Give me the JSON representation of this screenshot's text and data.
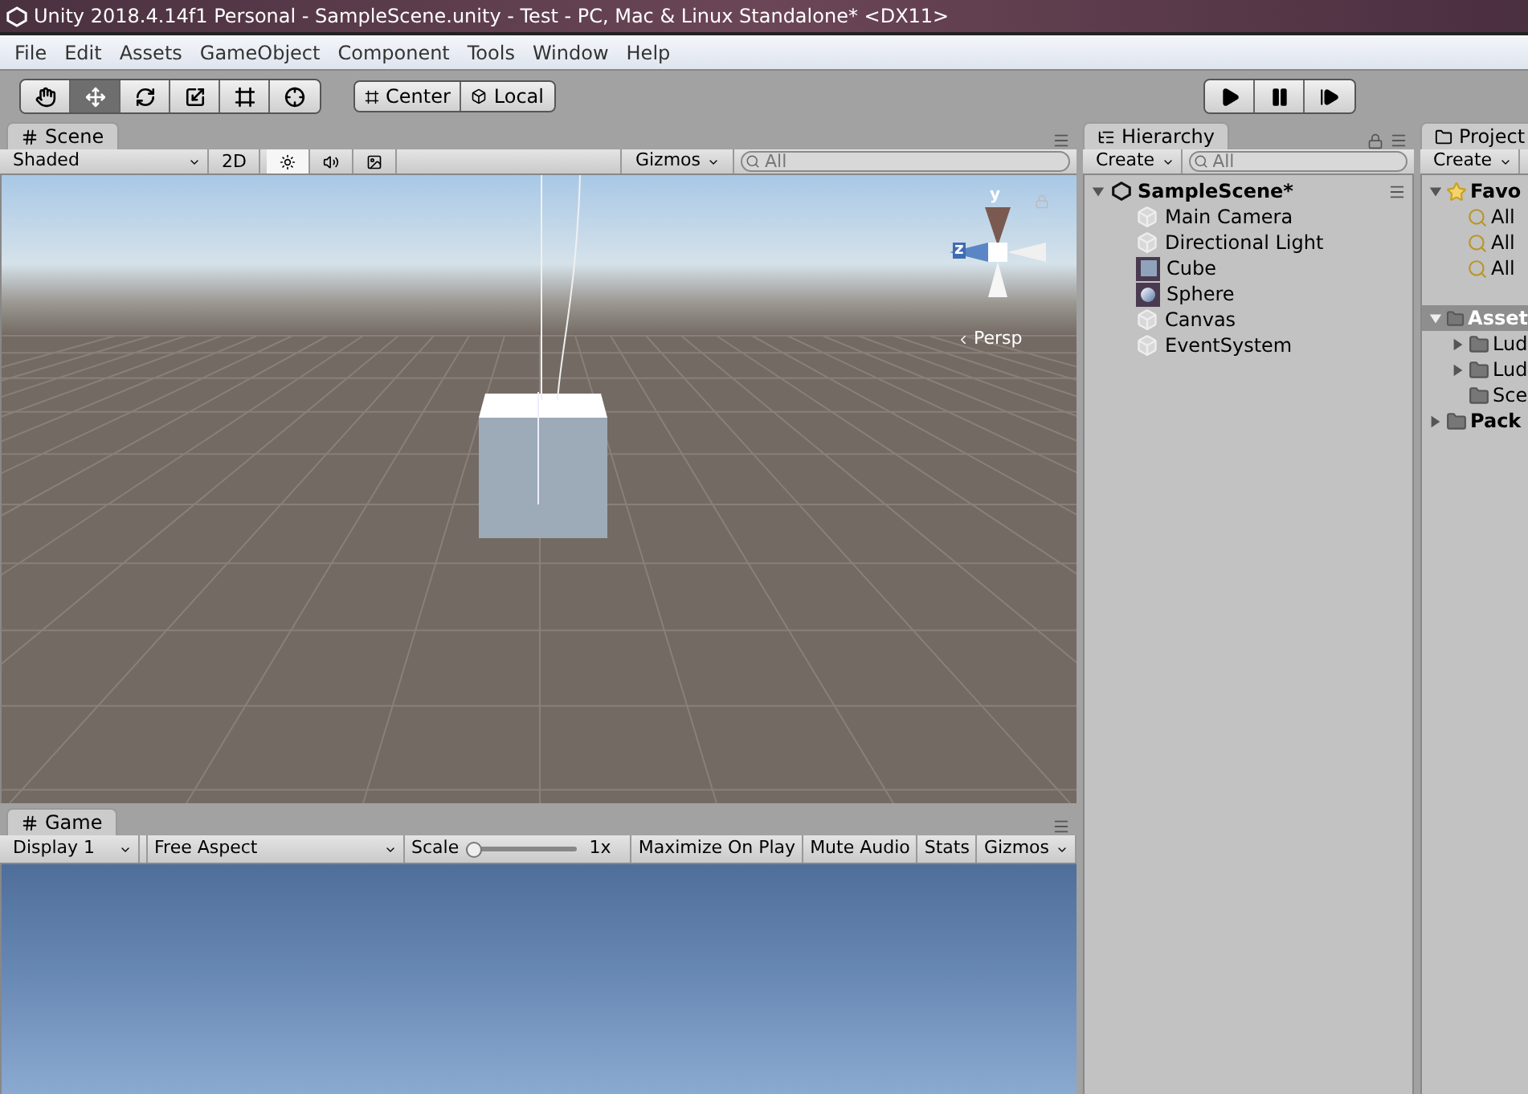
{
  "window": {
    "title": "Unity 2018.4.14f1 Personal - SampleScene.unity - Test - PC, Mac & Linux Standalone* <DX11>"
  },
  "menu": [
    "File",
    "Edit",
    "Assets",
    "GameObject",
    "Component",
    "Tools",
    "Window",
    "Help"
  ],
  "tools": [
    {
      "kind": "hand",
      "selected": false
    },
    {
      "kind": "move",
      "selected": true
    },
    {
      "kind": "rotate",
      "selected": false
    },
    {
      "kind": "scale",
      "selected": false
    },
    {
      "kind": "rect",
      "selected": false
    },
    {
      "kind": "transform",
      "selected": false
    }
  ],
  "pivot": [
    {
      "kind": "pivot",
      "label": "Center"
    },
    {
      "kind": "space",
      "label": "Local"
    }
  ],
  "play_controls": [
    {
      "kind": "play",
      "selected": false
    },
    {
      "kind": "pause",
      "selected": false
    },
    {
      "kind": "step",
      "selected": false
    }
  ],
  "scene": {
    "tab": "Scene",
    "shading": "Shaded",
    "mode_2d": {
      "label": "2D",
      "selected": false
    },
    "toggles": [
      {
        "kind": "lighting",
        "selected": true
      },
      {
        "kind": "audio",
        "selected": false
      },
      {
        "kind": "effects",
        "selected": false
      }
    ],
    "gizmos": "Gizmos",
    "search": {
      "placeholder": "All"
    },
    "gizmo_axes": {
      "y": "y",
      "z": "z",
      "projection": "Persp"
    }
  },
  "hierarchy": {
    "tab": "Hierarchy",
    "create": "Create",
    "search": {
      "placeholder": "All"
    },
    "scene": "SampleScene*",
    "items": [
      {
        "label": "Main Camera",
        "kind": "gameobject"
      },
      {
        "label": "Directional Light",
        "kind": "gameobject"
      },
      {
        "label": "Cube",
        "kind": "cube"
      },
      {
        "label": "Sphere",
        "kind": "sphere"
      },
      {
        "label": "Canvas",
        "kind": "gameobject"
      },
      {
        "label": "EventSystem",
        "kind": "gameobject"
      }
    ]
  },
  "project": {
    "tab": "Project",
    "create": "Create",
    "favorites": {
      "label": "Favo",
      "expanded": true,
      "children": [
        {
          "label": "All"
        },
        {
          "label": "All"
        },
        {
          "label": "All"
        }
      ]
    },
    "folders": [
      {
        "label": "Asset",
        "expanded": true,
        "selected": true,
        "children": [
          {
            "label": "Lud",
            "expanded": false
          },
          {
            "label": "Lud",
            "expanded": false
          },
          {
            "label": "Sce"
          }
        ]
      },
      {
        "label": "Pack",
        "expanded": false,
        "selected": false
      }
    ]
  },
  "game": {
    "tab": "Game",
    "display": "Display 1",
    "aspect": "Free Aspect",
    "scale_label": "Scale",
    "scale": {
      "level": 0.0
    },
    "scale_reading": "1x",
    "buttons": [
      {
        "label": "Maximize On Play",
        "selected": false
      },
      {
        "label": "Mute Audio",
        "selected": false
      },
      {
        "label": "Stats",
        "selected": false
      }
    ],
    "gizmos": "Gizmos"
  }
}
